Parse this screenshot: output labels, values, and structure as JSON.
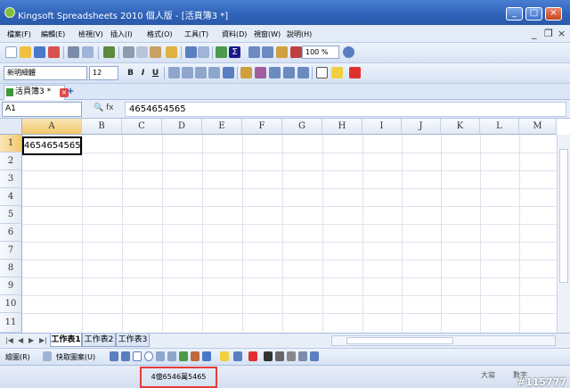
{
  "window": {
    "title": "Kingsoft Spreadsheets 2010 個人版 - [活頁簿3 *]",
    "minimize_glyph": "_",
    "maximize_glyph": "□",
    "close_glyph": "×"
  },
  "menu": {
    "items": [
      "檔案(F)",
      "編輯(E)",
      "檢視(V)",
      "插入(I)",
      "格式(O)",
      "工具(T)",
      "資料(D)",
      "視窗(W)",
      "說明(H)"
    ],
    "mdi_minimize": "_",
    "mdi_restore": "❐",
    "mdi_close": "×"
  },
  "toolbar": {
    "zoom": "100 %"
  },
  "format_bar": {
    "font": "新明細體",
    "size": "12",
    "bold": "B",
    "italic": "I",
    "underline": "U"
  },
  "doc_tab": {
    "label": "活頁簿3 *",
    "close_glyph": "×",
    "add_glyph": "+"
  },
  "formula_bar": {
    "name_box": "A1",
    "icons": "🔍 fx",
    "content": "4654654565"
  },
  "grid": {
    "columns": [
      "A",
      "B",
      "C",
      "D",
      "E",
      "F",
      "G",
      "H",
      "I",
      "J",
      "K",
      "L",
      "M"
    ],
    "rows": [
      "1",
      "2",
      "3",
      "4",
      "5",
      "6",
      "7",
      "8",
      "9",
      "10",
      "11"
    ],
    "cell_a1": "4654654565"
  },
  "sheets": {
    "tabs": [
      "工作表1",
      "工作表2",
      "工作表3"
    ],
    "nav": [
      "|◀",
      "◀",
      "▶",
      "▶|"
    ]
  },
  "draw_bar": {
    "draw_label": "繪圖(R)",
    "shapes_label": "快取圖案(U)"
  },
  "status": {
    "sum": "4億6546萬5465",
    "caps": "大寫",
    "num": "數字",
    "watermark": "#115777"
  }
}
